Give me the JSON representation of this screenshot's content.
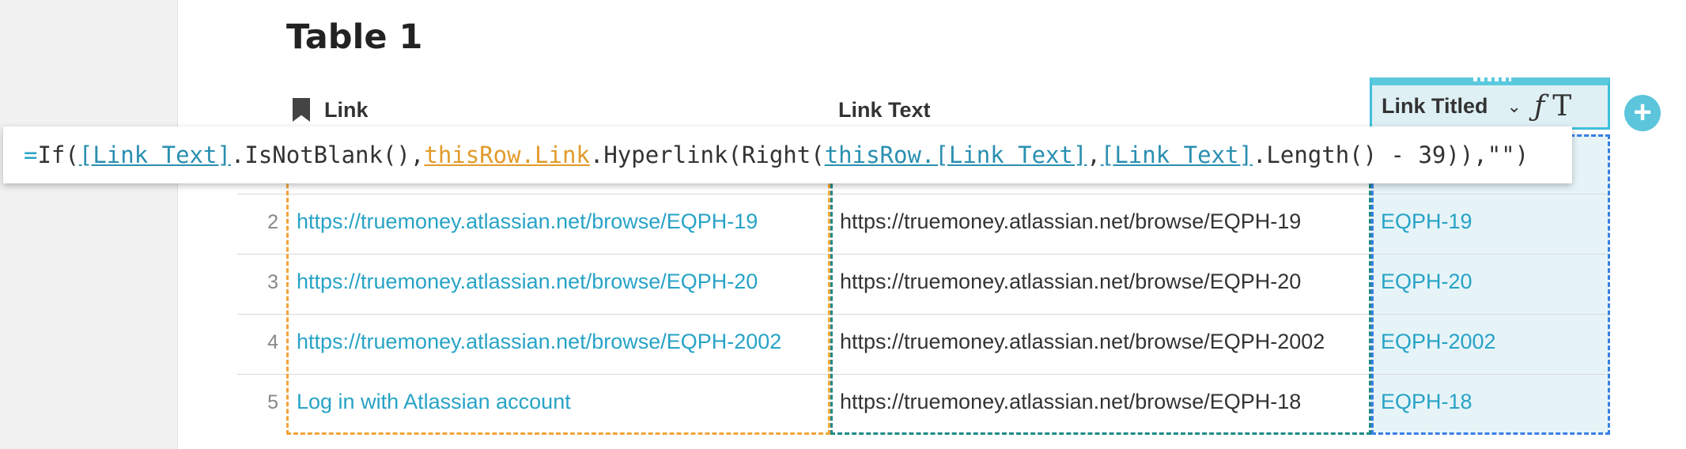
{
  "table": {
    "title": "Table 1"
  },
  "columns": {
    "link": "Link",
    "link_text": "Link Text",
    "link_titled": "Link Titled"
  },
  "header_icons": {
    "link_col": "bookmark-icon",
    "dropdown": "chevron-down-icon",
    "formula": "function-icon",
    "text_format": "text-format-icon",
    "add": "plus-icon"
  },
  "formula": {
    "eq": "=",
    "p1": "If(",
    "r1": "[Link Text]",
    "p2": ".IsNotBlank(),",
    "r2": "thisRow.Link",
    "p3": ".Hyperlink(Right(",
    "r3": "thisRow.[Link Text]",
    "p4": ",",
    "r4": "[Link Text]",
    "p5": ".Length() - 39)),\"\")"
  },
  "rows": [
    {
      "num": "2",
      "link": "https://truemoney.atlassian.net/browse/EQPH-19",
      "link_text": "https://truemoney.atlassian.net/browse/EQPH-19",
      "titled": "EQPH-19"
    },
    {
      "num": "3",
      "link": "https://truemoney.atlassian.net/browse/EQPH-20",
      "link_text": "https://truemoney.atlassian.net/browse/EQPH-20",
      "titled": "EQPH-20"
    },
    {
      "num": "4",
      "link": "https://truemoney.atlassian.net/browse/EQPH-2002",
      "link_text": "https://truemoney.atlassian.net/browse/EQPH-2002",
      "titled": "EQPH-2002"
    },
    {
      "num": "5",
      "link": "Log in with Atlassian account",
      "link_text": "https://truemoney.atlassian.net/browse/EQPH-18",
      "titled": "EQPH-18"
    }
  ],
  "colors": {
    "accent": "#27a3c6",
    "orange_ref": "#f0a53a",
    "teal_ref": "#1d8a86",
    "blue_ref": "#3a7fe6"
  }
}
